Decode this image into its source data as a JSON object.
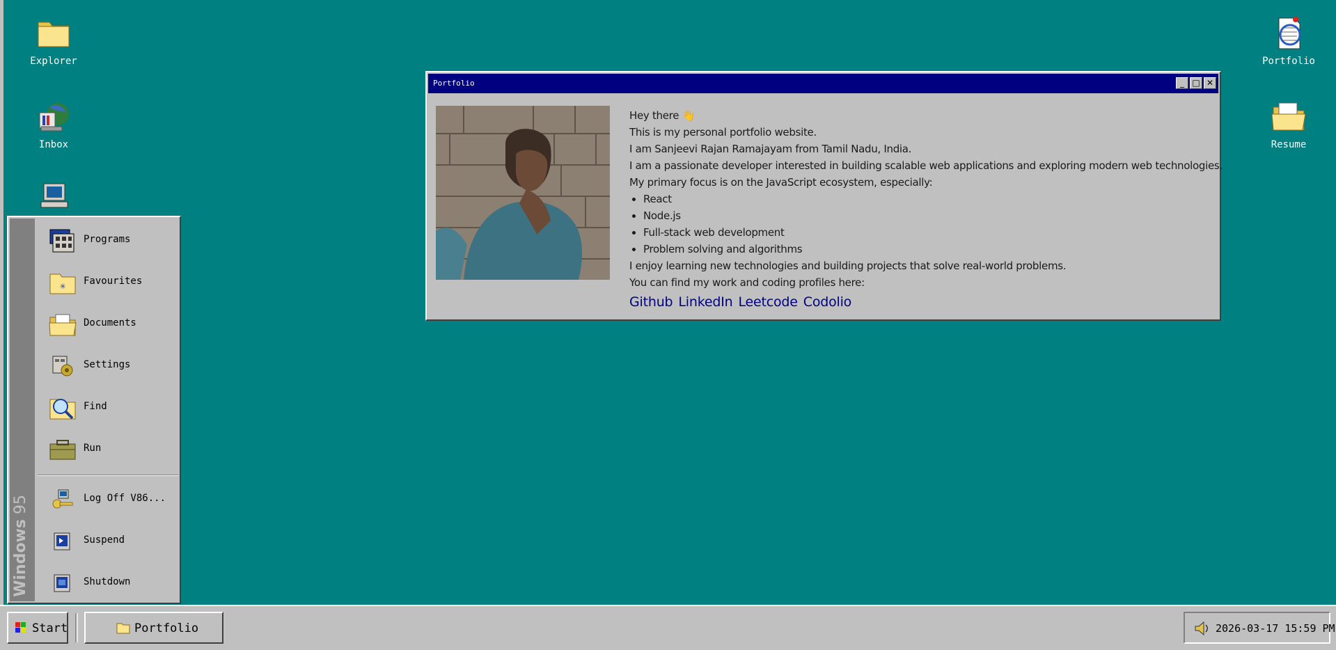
{
  "desktop": {
    "icons_left": [
      {
        "label": "Explorer",
        "icon": "folder-icon"
      },
      {
        "label": "Inbox",
        "icon": "inbox-icon"
      },
      {
        "label": "",
        "icon": "computer-icon"
      }
    ],
    "icons_right": [
      {
        "label": "Portfolio",
        "icon": "document-icon"
      },
      {
        "label": "Resume",
        "icon": "open-folder-icon"
      }
    ]
  },
  "window": {
    "title": "Portfolio",
    "buttons": {
      "minimize": "_",
      "maximize": "□",
      "close": "✕"
    },
    "content": {
      "greeting": "Hey there 👋",
      "lines": [
        "This is my personal portfolio website.",
        "I am Sanjeevi Rajan Ramajayam from Tamil Nadu, India.",
        "I am a passionate developer interested in building scalable web applications and exploring modern web technologies.",
        "My primary focus is on the JavaScript ecosystem, especially:"
      ],
      "skills": [
        "React",
        "Node.js",
        "Full-stack web development",
        "Problem solving and algorithms"
      ],
      "closing": [
        "I enjoy learning new technologies and building projects that solve real-world problems.",
        "You can find my work and coding profiles here:"
      ],
      "links": [
        "Github",
        "LinkedIn",
        "Leetcode",
        "Codolio"
      ]
    }
  },
  "start_menu": {
    "banner": {
      "bold": "Windows",
      "light": "95"
    },
    "items": [
      {
        "label": "Programs",
        "icon": "programs-icon"
      },
      {
        "label": "Favourites",
        "icon": "favourites-folder-icon"
      },
      {
        "label": "Documents",
        "icon": "documents-folder-icon"
      },
      {
        "label": "Settings",
        "icon": "settings-icon"
      },
      {
        "label": "Find",
        "icon": "find-magnifier-icon"
      },
      {
        "label": "Run",
        "icon": "run-icon"
      },
      {
        "label": "Log Off V86...",
        "icon": "logoff-key-icon"
      },
      {
        "label": "Suspend",
        "icon": "suspend-icon"
      },
      {
        "label": "Shutdown",
        "icon": "shutdown-icon"
      }
    ]
  },
  "taskbar": {
    "start_label": "Start",
    "task_label": "Portfolio",
    "clock": "2026-03-17 15:59 PM"
  },
  "colors": {
    "desktop": "#008080",
    "titlebar": "#000080",
    "chrome": "#c0c0c0",
    "link": "#000080"
  }
}
